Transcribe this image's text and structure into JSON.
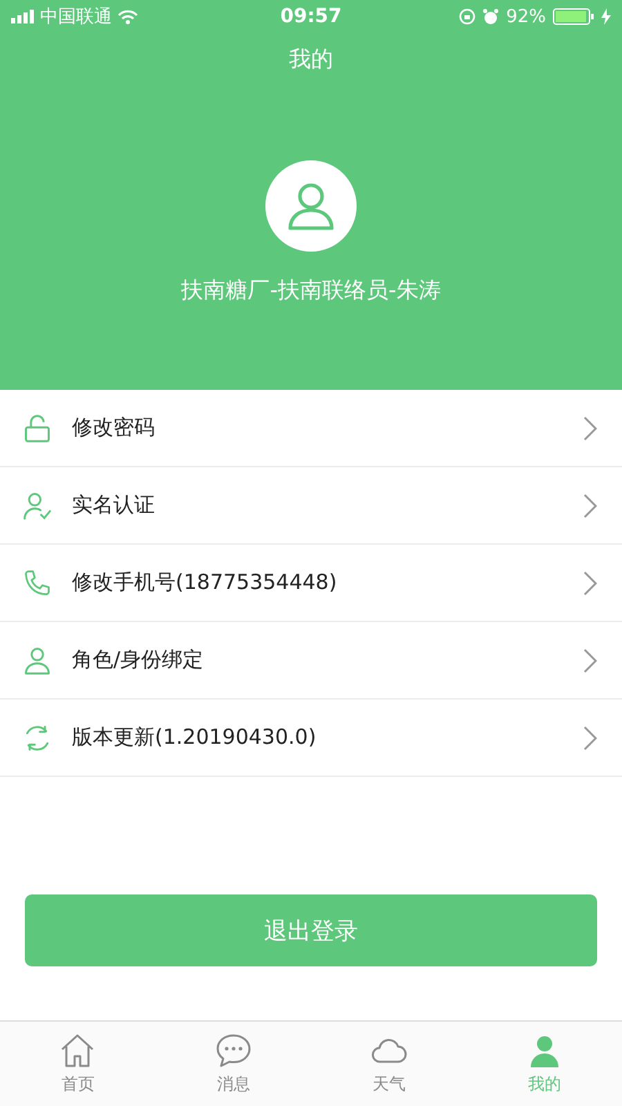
{
  "status_bar": {
    "carrier": "中国联通",
    "time": "09:57",
    "battery": "92%"
  },
  "header": {
    "title": "我的",
    "user_name": "扶南糖厂-扶南联络员-朱涛"
  },
  "menu": [
    {
      "kind": "lock",
      "label": "修改密码"
    },
    {
      "kind": "verify",
      "label": "实名认证"
    },
    {
      "kind": "phone",
      "label": "修改手机号(18775354448)"
    },
    {
      "kind": "person",
      "label": "角色/身份绑定"
    },
    {
      "kind": "update",
      "label": "版本更新(1.20190430.0)"
    }
  ],
  "logout_button": "退出登录",
  "tab_bar": [
    {
      "kind": "home",
      "label": "首页",
      "selected": false
    },
    {
      "kind": "message",
      "label": "消息",
      "selected": false
    },
    {
      "kind": "weather",
      "label": "天气",
      "selected": false
    },
    {
      "kind": "me",
      "label": "我的",
      "selected": true
    }
  ]
}
